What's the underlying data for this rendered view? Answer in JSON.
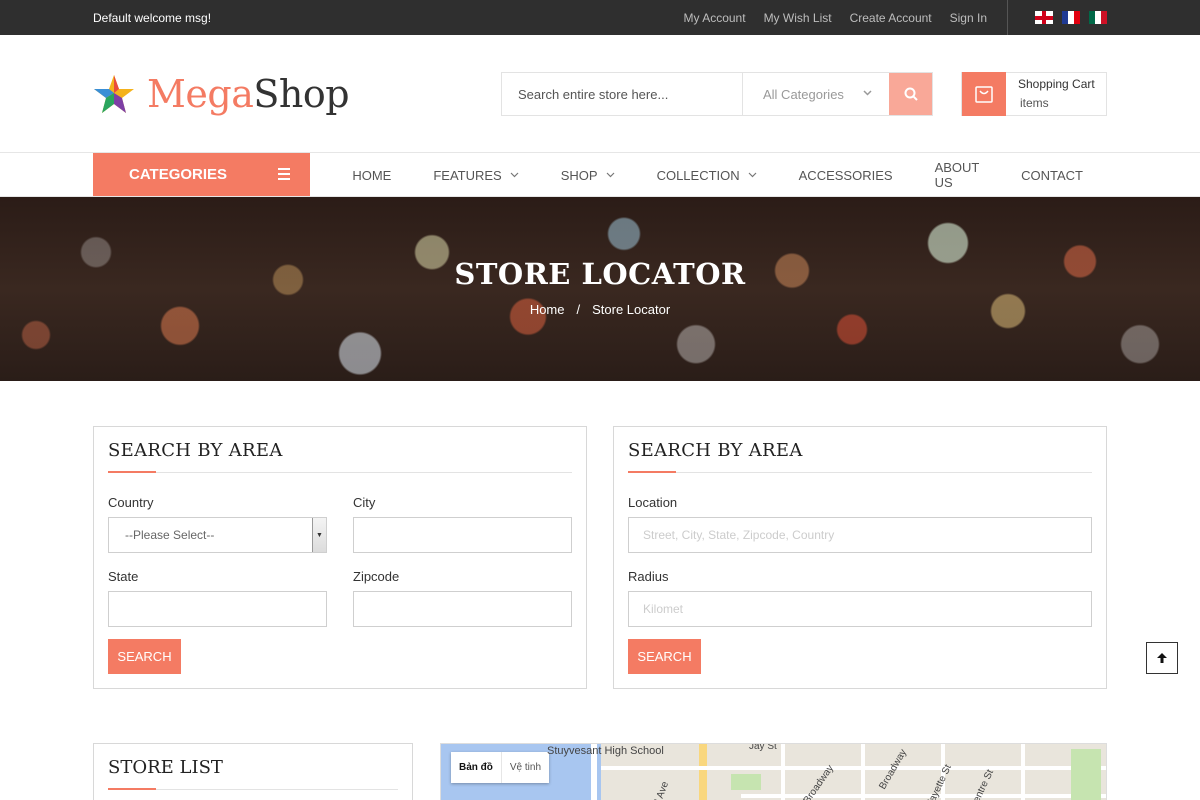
{
  "topbar": {
    "welcome": "Default welcome msg!",
    "links": [
      "My Account",
      "My Wish List",
      "Create Account",
      "Sign In"
    ],
    "flags": [
      "english-flag",
      "french-flag",
      "mexican-flag"
    ]
  },
  "header": {
    "logo_part1": "Mega",
    "logo_part2": "Shop",
    "search_placeholder": "Search entire store here...",
    "category_select": "All Categories",
    "cart_title": "Shopping Cart",
    "cart_items": "items"
  },
  "nav": {
    "categories_label": "CATEGORIES",
    "menu": [
      {
        "label": "HOME"
      },
      {
        "label": "FEATURES"
      },
      {
        "label": "SHOP"
      },
      {
        "label": "COLLECTION"
      },
      {
        "label": "ACCESSORIES"
      },
      {
        "label": "ABOUT US"
      },
      {
        "label": "CONTACT"
      }
    ]
  },
  "banner": {
    "title": "STORE LOCATOR",
    "breadcrumb_home": "Home",
    "breadcrumb_sep": "/",
    "breadcrumb_current": "Store Locator"
  },
  "area_panel": {
    "title": "SEARCH BY AREA",
    "country_label": "Country",
    "country_value": "--Please Select--",
    "city_label": "City",
    "state_label": "State",
    "zipcode_label": "Zipcode",
    "search_label": "SEARCH"
  },
  "location_panel": {
    "title": "SEARCH BY AREA",
    "location_label": "Location",
    "location_placeholder": "Street, City, State, Zipcode, Country",
    "radius_label": "Radius",
    "radius_placeholder": "Kilomet",
    "search_label": "SEARCH"
  },
  "store_list": {
    "title": "STORE LIST"
  },
  "map": {
    "toggle_map": "Bản đồ",
    "toggle_satellite": "Vệ tinh",
    "labels": [
      "Stuyvesant High School",
      "Jay St",
      "W Broadway",
      "Broadway",
      "Lafayette St",
      "Centre St",
      "End Ave"
    ]
  },
  "colors": {
    "accent": "#f47b63",
    "topbar": "#2f2f2f"
  }
}
